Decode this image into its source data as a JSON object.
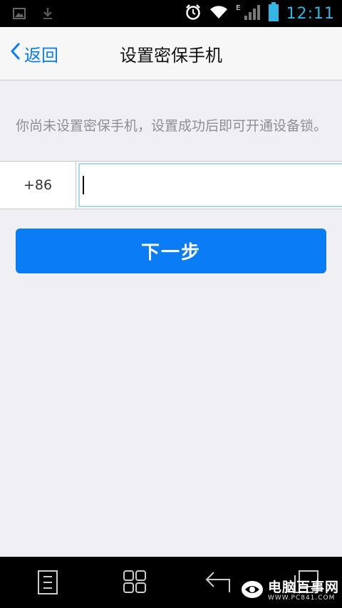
{
  "status_bar": {
    "time": "12:11",
    "network_type": "E",
    "icons": [
      "image-icon",
      "download-icon",
      "alarm-icon",
      "wifi-icon",
      "signal-icon",
      "battery-icon"
    ]
  },
  "nav": {
    "back_label": "返回",
    "title": "设置密保手机"
  },
  "hint_text": "你尚未设置密保手机，设置成功后即可开通设备锁。",
  "phone": {
    "country_code": "+86",
    "value": "",
    "placeholder": ""
  },
  "next_button_label": "下一步",
  "system_nav": {
    "buttons": [
      "menu-icon",
      "recent-apps-icon",
      "back-icon",
      "window-icon"
    ]
  },
  "watermark": {
    "text": "电脑百事网",
    "sub": "WWW.PC841.COM"
  },
  "colors": {
    "accent": "#0a7cf5",
    "status_icon": "#33b5e5",
    "background": "#efeff4"
  }
}
